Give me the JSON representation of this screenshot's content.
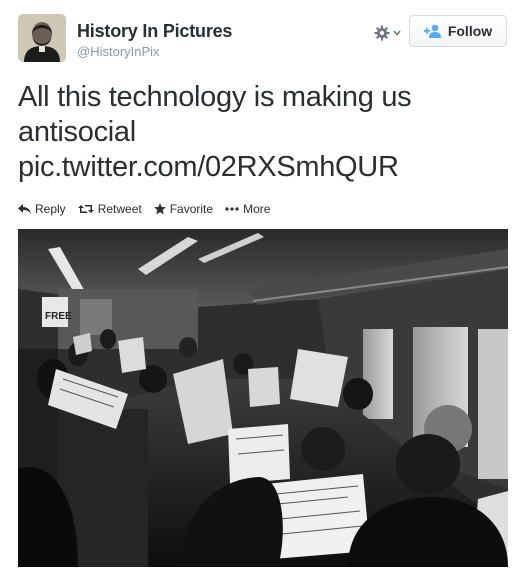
{
  "user": {
    "display_name": "History In Pictures",
    "handle": "@HistoryInPix",
    "avatar_icon": "portrait-avatar"
  },
  "header": {
    "settings_icon": "gear-icon",
    "follow_label": "Follow",
    "follow_icon": "add-user-icon"
  },
  "tweet": {
    "lines": [
      "All this technology is making us",
      "antisocial",
      "pic.twitter.com/02RXSmhQUR"
    ]
  },
  "actions": [
    {
      "label": "Reply",
      "icon": "reply-icon"
    },
    {
      "label": "Retweet",
      "icon": "retweet-icon"
    },
    {
      "label": "Favorite",
      "icon": "star-icon"
    },
    {
      "label": "More",
      "icon": "more-icon"
    }
  ],
  "media": {
    "sign_text": "FREE"
  },
  "colors": {
    "text": "#292f33",
    "muted": "#8899a6",
    "follow_accent": "#55acee"
  }
}
